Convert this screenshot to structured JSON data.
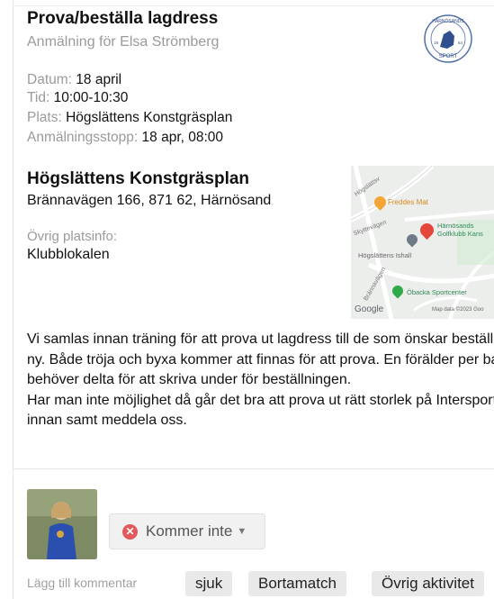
{
  "event": {
    "title": "Prova/beställa lagdress",
    "subtitle": "Anmälning för Elsa Strömberg",
    "logo_text": "HÄRNÖSANDS SPORT 1964",
    "details": [
      {
        "key": "Datum:",
        "value": "18 april"
      },
      {
        "key": "Tid:",
        "value": "10:00-10:30"
      },
      {
        "key": "Plats:",
        "value": "Högslättens Konstgräsplan"
      },
      {
        "key": "Anmälningsstopp:",
        "value": "18 apr, 08:00"
      }
    ]
  },
  "location": {
    "title": "Högslättens Konstgräsplan",
    "address": "Brännavägen 166, 871 62, Härnösand",
    "extra_label": "Övrig platsinfo:",
    "extra_value": "Klubblokalen"
  },
  "map": {
    "pois": [
      "Freddes Mat",
      "Härnösands",
      "Golfklubb Kans",
      "Högslättens Ishall",
      "Öbacka Sportcenter"
    ],
    "streets": [
      "Högslättsv",
      "Brännavägen",
      "Skyttevägen"
    ],
    "attribution": "Map data ©2023 Goo",
    "brand": "Google"
  },
  "description": {
    "p1": "Vi samlas innan träning för att prova ut lagdress till de som önskar beställa ny. Både tröja och byxa kommer att finnas för att prova. En förälder per barn behöver delta för att skriva under för beställningen.",
    "p2": "Har man inte möjlighet då går det bra att prova ut rätt storlek på Intersport innan samt meddela oss."
  },
  "response": {
    "status_label": "Kommer inte",
    "status_color": "#e2585b"
  },
  "comment": {
    "label": "Lägg till kommentar",
    "quick_options": [
      "sjuk",
      "Bortamatch",
      "Övrig aktivitet"
    ]
  }
}
